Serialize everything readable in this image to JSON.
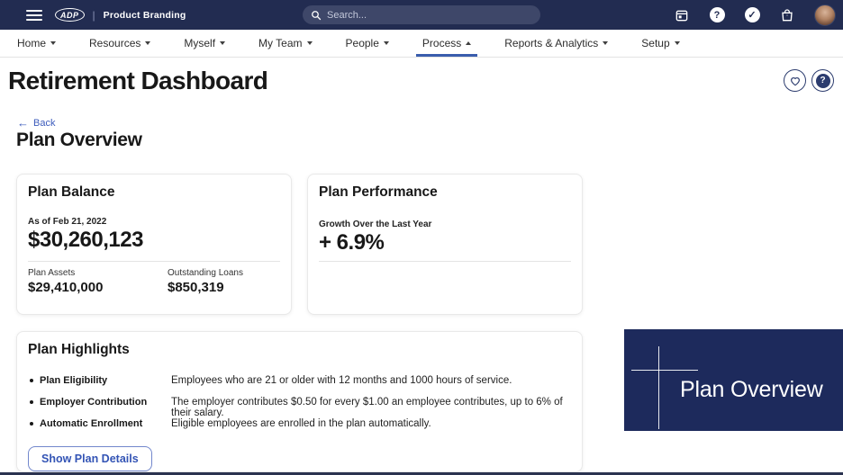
{
  "topbar": {
    "brand": "ADP",
    "product": "Product Branding",
    "search_placeholder": "Search...",
    "help_glyph": "?",
    "check_glyph": "✓"
  },
  "nav": {
    "items": [
      {
        "label": "Home"
      },
      {
        "label": "Resources"
      },
      {
        "label": "Myself"
      },
      {
        "label": "My Team"
      },
      {
        "label": "People"
      },
      {
        "label": "Process",
        "active": true
      },
      {
        "label": "Reports & Analytics"
      },
      {
        "label": "Setup"
      }
    ]
  },
  "page": {
    "title": "Retirement Dashboard",
    "back_label": "Back",
    "back_arrow": "←",
    "section_title": "Plan Overview",
    "help_glyph": "?"
  },
  "cards": {
    "balance": {
      "title": "Plan Balance",
      "as_of": "As of Feb 21, 2022",
      "amount": "$30,260,123",
      "stats": [
        {
          "label": "Plan Assets",
          "value": "$29,410,000"
        },
        {
          "label": "Outstanding Loans",
          "value": "$850,319"
        }
      ]
    },
    "performance": {
      "title": "Plan Performance",
      "label": "Growth Over the Last Year",
      "value": "+ 6.9%"
    },
    "highlights": {
      "title": "Plan Highlights",
      "items": [
        {
          "label": "Plan Eligibility",
          "description": "Employees who are 21 or older with 12 months and 1000 hours of service."
        },
        {
          "label": "Employer Contribution",
          "description": "The employer contributes $0.50 for every $1.00 an employee contributes, up to 6% of their salary."
        },
        {
          "label": "Automatic Enrollment",
          "description": "Eligible employees are enrolled in the plan automatically."
        }
      ],
      "button_label": "Show Plan Details"
    }
  },
  "banner": {
    "title": "Plan Overview"
  },
  "colors": {
    "topbar_bg": "#222c51",
    "search_bg": "#3e4769",
    "nav_active_underline": "#3a5dad",
    "link_blue": "#3d5cbc",
    "button_blue": "#3354b5",
    "banner_bg": "#1d2a5c",
    "text_dark": "#181818"
  }
}
